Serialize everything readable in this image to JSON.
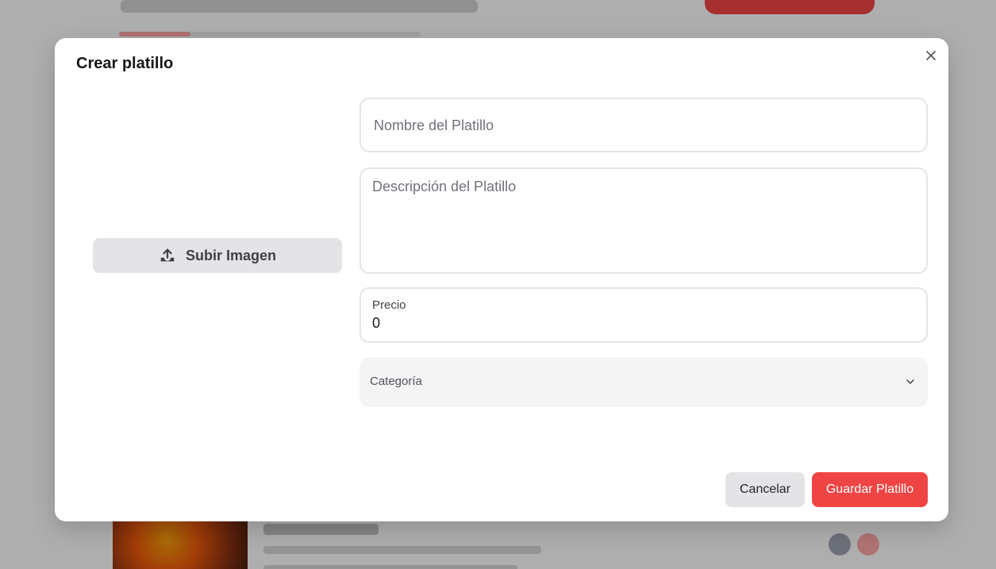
{
  "modal": {
    "title": "Crear platillo",
    "close_icon": "close-icon"
  },
  "upload": {
    "label": "Subir Imagen",
    "icon": "upload-icon"
  },
  "form": {
    "name": {
      "placeholder": "Nombre del Platillo",
      "value": ""
    },
    "description": {
      "placeholder": "Descripción del Platillo",
      "value": ""
    },
    "price": {
      "label": "Precio",
      "value": "0"
    },
    "category": {
      "label": "Categoría",
      "icon": "chevron-down-icon"
    }
  },
  "actions": {
    "cancel_label": "Cancelar",
    "save_label": "Guardar Platillo"
  },
  "colors": {
    "accent": "#ef4444",
    "overlay": "rgba(0,0,0,0.30)"
  }
}
